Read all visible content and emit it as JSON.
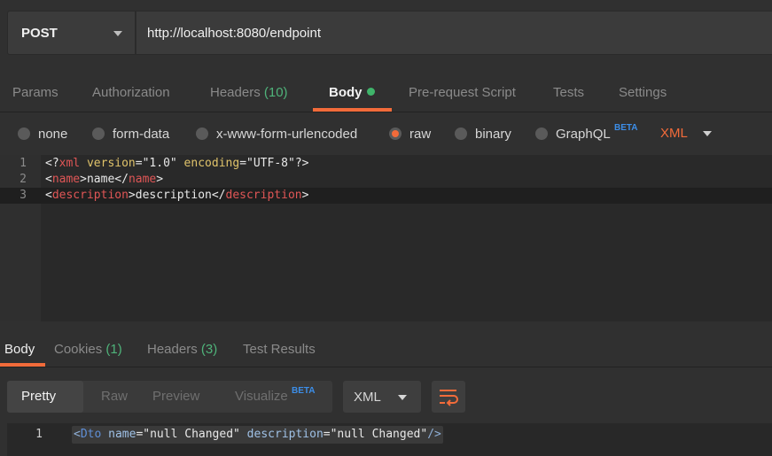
{
  "request": {
    "method": "POST",
    "url": "http://localhost:8080/endpoint"
  },
  "request_tabs": [
    {
      "label": "Params"
    },
    {
      "label": "Authorization"
    },
    {
      "label": "Headers",
      "count": "(10)"
    },
    {
      "label": "Body",
      "active": true,
      "indicator": "green-dot"
    },
    {
      "label": "Pre-request Script"
    },
    {
      "label": "Tests"
    },
    {
      "label": "Settings"
    }
  ],
  "body_types": {
    "options": [
      "none",
      "form-data",
      "x-www-form-urlencoded",
      "raw",
      "binary",
      "GraphQL"
    ],
    "selected": "raw",
    "graphql_badge": "BETA",
    "language": "XML"
  },
  "editor": {
    "line_numbers": [
      "1",
      "2",
      "3"
    ],
    "lines": [
      {
        "t1": "<?",
        "t2": "xml",
        "t3": " version",
        "t4": "=\"1.0\"",
        "t5": " encoding",
        "t6": "=\"UTF-8\"",
        "t7": "?>"
      },
      {
        "t1": "<",
        "t2": "name",
        "t3": ">name</",
        "t4": "name",
        "t5": ">"
      },
      {
        "t1": "<",
        "t2": "description",
        "t3": ">description</",
        "t4": "description",
        "t5": ">"
      }
    ]
  },
  "response_tabs": [
    {
      "label": "Body",
      "active": true
    },
    {
      "label": "Cookies",
      "count": "(1)"
    },
    {
      "label": "Headers",
      "count": "(3)"
    },
    {
      "label": "Test Results"
    }
  ],
  "response_view": {
    "modes": [
      "Pretty",
      "Raw",
      "Preview",
      "Visualize"
    ],
    "active_mode": "Pretty",
    "visualize_badge": "BETA",
    "format": "XML",
    "wrap_icon": "wrap-lines-icon"
  },
  "response_body": {
    "line_number": "1",
    "tokens": {
      "t1": "<",
      "t2": "Dto",
      "t3": " name",
      "t4": "=\"null Changed\"",
      "t5": " description",
      "t6": "=\"null Changed\"",
      "t7": "/>"
    }
  },
  "colors": {
    "accent": "#f26b3a",
    "count_green": "#4fb37a",
    "beta_blue": "#3c8ee8",
    "xml_tag": "#e05656",
    "xml_attr": "#e0c36a"
  }
}
